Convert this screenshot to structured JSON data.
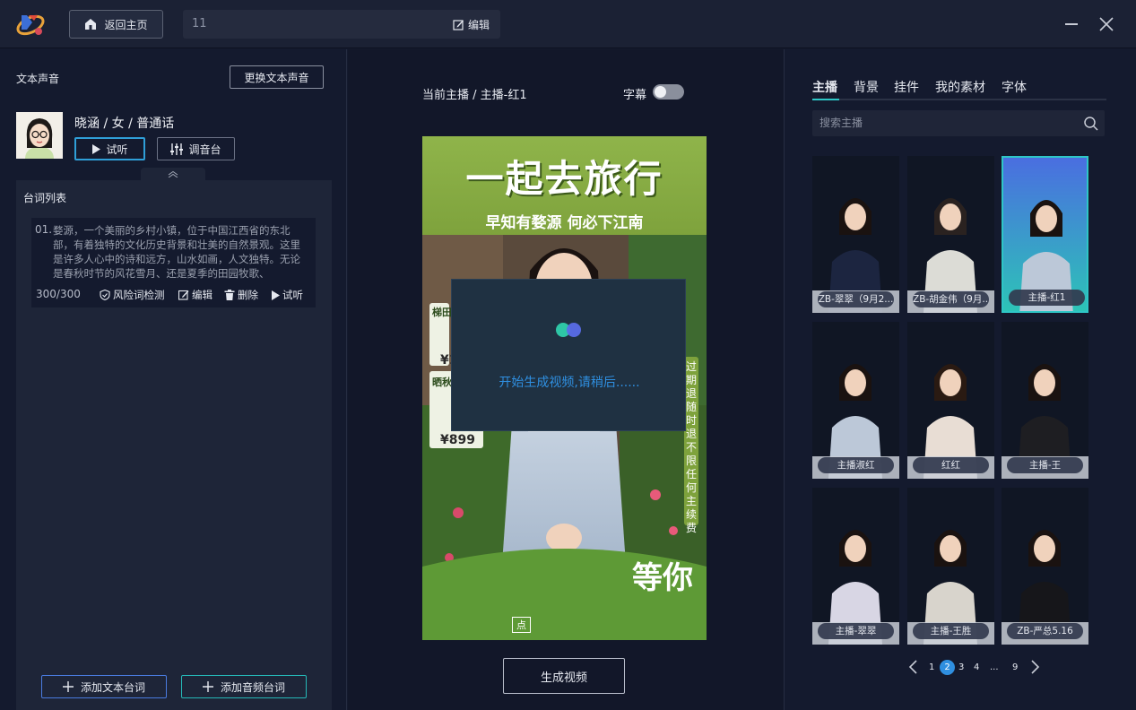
{
  "topbar": {
    "home_label": "返回主页",
    "project_name": "11",
    "edit_label": "编辑"
  },
  "voice": {
    "section_title": "文本声音",
    "change_label": "更换文本声音",
    "name": "晓涵 / 女 / 普通话",
    "listen_label": "试听",
    "mixer_label": "调音台"
  },
  "scripts": {
    "title": "台词列表",
    "items": [
      {
        "num": "01.",
        "text": "婺源，一个美丽的乡村小镇，位于中国江西省的东北部，有着独特的文化历史背景和壮美的自然景观。这里是许多人心中的诗和远方，山水如画，人文独特。无论是春秋时节的风花雪月、还是夏季的田园牧歌、",
        "count": "300/300",
        "risk_label": "风险词检测",
        "edit_label": "编辑",
        "delete_label": "删除",
        "listen_label": "试听"
      }
    ],
    "add_text_label": "添加文本台词",
    "add_audio_label": "添加音频台词"
  },
  "center": {
    "current_host": "当前主播 / 主播-红1",
    "subtitle_label": "字幕",
    "subtitle_on": false,
    "poster_title": "一起去旅行",
    "poster_subtitle": "早知有婺源  何必下江南",
    "poster_side_text": "过期退 随时退 不限任何主续费",
    "poster_tag1": "梯田",
    "poster_tag2": "晒秋",
    "poster_price1": "¥1",
    "poster_price2": "¥899",
    "poster_bottom": "等你",
    "poster_link": "点",
    "loading_text": "开始生成视频,请稍后......",
    "generate_label": "生成视频"
  },
  "right": {
    "tabs": [
      "主播",
      "背景",
      "挂件",
      "我的素材",
      "字体"
    ],
    "active_tab": 0,
    "search_placeholder": "搜索主播",
    "hosts": [
      {
        "label": "ZB-翠翠（9月2...",
        "bg": "#101624",
        "shirt": "#1c2540",
        "hair": "#1a1210"
      },
      {
        "label": "ZB-胡金伟（9月...",
        "bg": "#101624",
        "shirt": "#dcdcd6",
        "hair": "#2a2220"
      },
      {
        "label": "主播-红1",
        "bg": "#3d8be0",
        "shirt": "#bcc8d8",
        "hair": "#1a1210",
        "selected": true
      },
      {
        "label": "主播淑红",
        "bg": "#101624",
        "shirt": "#bcc8d8",
        "hair": "#1a1210"
      },
      {
        "label": "红红",
        "bg": "#101624",
        "shirt": "#e8ddd4",
        "hair": "#2a1a12"
      },
      {
        "label": "主播-王",
        "bg": "#101624",
        "shirt": "#1e1e22",
        "hair": "#1a1210"
      },
      {
        "label": "主播-翠翠",
        "bg": "#101624",
        "shirt": "#d8d6e4",
        "hair": "#1a1210"
      },
      {
        "label": "主播-王胜",
        "bg": "#101624",
        "shirt": "#d8d4cc",
        "hair": "#1a1210"
      },
      {
        "label": "ZB-严总5.16",
        "bg": "#101624",
        "shirt": "#16161a",
        "hair": "#1a1210"
      }
    ],
    "pagination": {
      "pages": [
        "1",
        "2",
        "3",
        "4",
        "...",
        "9"
      ],
      "current": "2"
    }
  }
}
